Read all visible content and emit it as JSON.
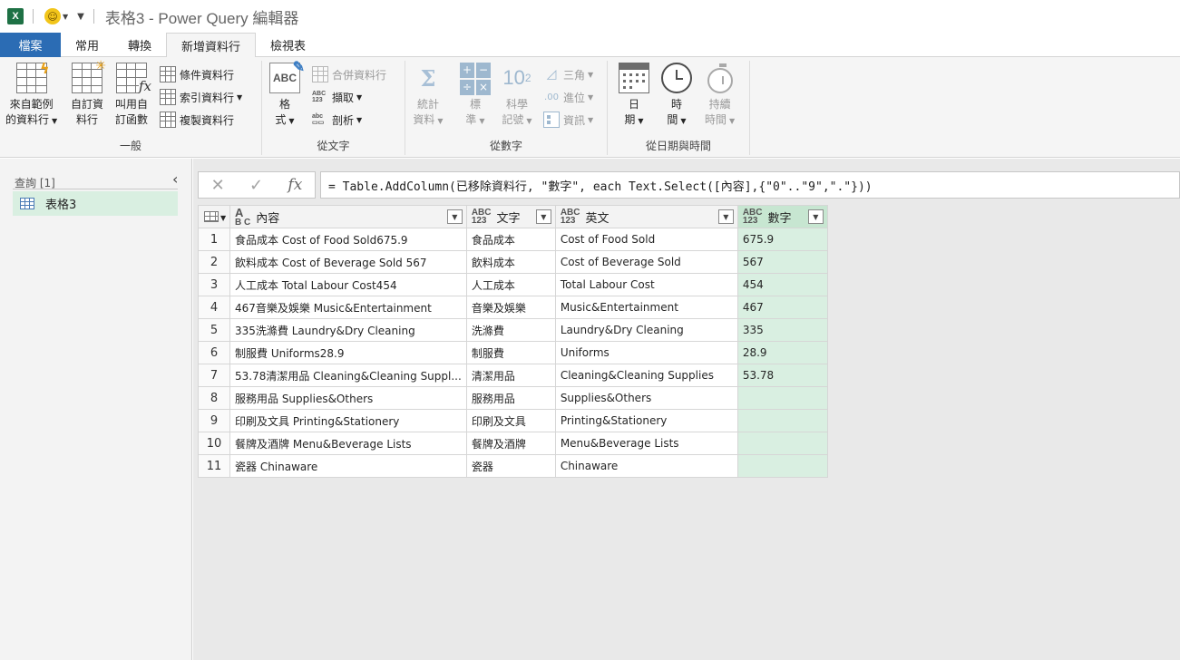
{
  "titlebar": {
    "app_icon_letter": "X",
    "title": "表格3 - Power Query 編輯器"
  },
  "tabs": [
    {
      "label": "檔案"
    },
    {
      "label": "常用"
    },
    {
      "label": "轉換"
    },
    {
      "label": "新增資料行"
    },
    {
      "label": "檢視表"
    }
  ],
  "ribbon": {
    "general": {
      "group_label": "一般",
      "from_example_line1": "來自範例",
      "from_example_line2": "的資料行",
      "custom_line1": "自訂資",
      "custom_line2": "料行",
      "invoke_line1": "叫用自",
      "invoke_line2": "訂函數",
      "conditional": "條件資料行",
      "index": "索引資料行",
      "duplicate": "複製資料行"
    },
    "from_text": {
      "group_label": "從文字",
      "format_line1": "格",
      "format_line2": "式",
      "merge": "合併資料行",
      "extract": "擷取",
      "parse": "剖析"
    },
    "from_number": {
      "group_label": "從數字",
      "stats_line1": "統計",
      "stats_line2": "資料",
      "standard_line1": "標",
      "standard_line2": "準",
      "scientific_line1": "科學",
      "scientific_line2": "記號",
      "trig": "三角",
      "rounding": "進位",
      "info": "資訊",
      "pow_base": "10",
      "pow_exp": "2"
    },
    "from_datetime": {
      "group_label": "從日期與時間",
      "date_line1": "日",
      "date_line2": "期",
      "time_line1": "時",
      "time_line2": "間",
      "duration_line1": "持續",
      "duration_line2": "時間"
    }
  },
  "queries_pane": {
    "header": "查詢 [1]",
    "items": [
      {
        "name": "表格3"
      }
    ]
  },
  "formula_bar": {
    "formula": "= Table.AddColumn(已移除資料行, \"數字\", each Text.Select([內容],{\"0\"..\"9\",\".\"}))"
  },
  "table": {
    "columns": [
      {
        "name": "內容",
        "type_top": "A",
        "type_bottom": "B C",
        "kind": "text"
      },
      {
        "name": "文字",
        "type_top": "ABC",
        "type_bottom": "123",
        "kind": "any"
      },
      {
        "name": "英文",
        "type_top": "ABC",
        "type_bottom": "123",
        "kind": "any"
      },
      {
        "name": "數字",
        "type_top": "ABC",
        "type_bottom": "123",
        "kind": "any"
      }
    ],
    "rows": [
      {
        "n": "1",
        "c1": "食品成本 Cost of Food Sold675.9",
        "c2": "食品成本",
        "c3": "Cost of Food Sold",
        "c4": "675.9"
      },
      {
        "n": "2",
        "c1": "飲料成本 Cost of Beverage Sold 567",
        "c2": "飲料成本",
        "c3": "Cost of Beverage Sold",
        "c4": "567"
      },
      {
        "n": "3",
        "c1": "人工成本 Total Labour Cost454",
        "c2": "人工成本",
        "c3": "Total Labour Cost",
        "c4": "454"
      },
      {
        "n": "4",
        "c1": "467音樂及娛樂 Music&Entertainment",
        "c2": "音樂及娛樂",
        "c3": "Music&Entertainment",
        "c4": "467"
      },
      {
        "n": "5",
        "c1": "335洗滌費 Laundry&Dry Cleaning",
        "c2": "洗滌費",
        "c3": "Laundry&Dry Cleaning",
        "c4": "335"
      },
      {
        "n": "6",
        "c1": "制服費 Uniforms28.9",
        "c2": "制服費",
        "c3": "Uniforms",
        "c4": "28.9"
      },
      {
        "n": "7",
        "c1": "53.78清潔用品 Cleaning&Cleaning Suppl...",
        "c2": "清潔用品",
        "c3": "Cleaning&Cleaning Supplies",
        "c4": "53.78"
      },
      {
        "n": "8",
        "c1": "服務用品 Supplies&Others",
        "c2": "服務用品",
        "c3": "Supplies&Others",
        "c4": ""
      },
      {
        "n": "9",
        "c1": "印刷及文具 Printing&Stationery",
        "c2": "印刷及文具",
        "c3": "Printing&Stationery",
        "c4": ""
      },
      {
        "n": "10",
        "c1": "餐牌及酒牌 Menu&Beverage Lists",
        "c2": "餐牌及酒牌",
        "c3": "Menu&Beverage Lists",
        "c4": ""
      },
      {
        "n": "11",
        "c1": "瓷器 Chinaware",
        "c2": "瓷器",
        "c3": "Chinaware",
        "c4": ""
      }
    ]
  },
  "colors": {
    "file_tab": "#2b6cb4",
    "selected_column": "#d9efe1",
    "excel_green": "#1e7145"
  }
}
